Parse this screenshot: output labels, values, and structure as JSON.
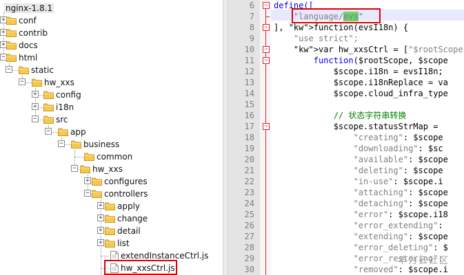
{
  "tree": {
    "root": "nginx-1.8.1",
    "items": [
      {
        "label": "conf"
      },
      {
        "label": "contrib"
      },
      {
        "label": "docs"
      },
      {
        "label": "html"
      },
      {
        "label": "static"
      },
      {
        "label": "hw_xxs"
      },
      {
        "label": "config"
      },
      {
        "label": "i18n"
      },
      {
        "label": "src"
      },
      {
        "label": "app"
      },
      {
        "label": "business"
      },
      {
        "label": "common"
      },
      {
        "label": "hw_xxs"
      },
      {
        "label": "configures"
      },
      {
        "label": "controllers"
      },
      {
        "label": "apply"
      },
      {
        "label": "change"
      },
      {
        "label": "detail"
      },
      {
        "label": "list"
      },
      {
        "label": "extendInstanceCtrl.js"
      },
      {
        "label": "hw_xxsCtrl.js"
      }
    ],
    "colors": {
      "folder": "#f4c94c",
      "highlight_box": "#e00000"
    }
  },
  "editor": {
    "lines": [
      {
        "n": "6",
        "t": "define(["
      },
      {
        "n": "7",
        "a": "\"language/",
        "h": "evs",
        "b": "\""
      },
      {
        "n": "8",
        "t": "], function(evsI18n) {"
      },
      {
        "n": "9",
        "t": "    \"use strict\";"
      },
      {
        "n": "10",
        "t": "    var hw_xxsCtrl = [\"$rootScope\""
      },
      {
        "n": "11",
        "t": "        function($rootScope, $scope"
      },
      {
        "n": "12",
        "t": "            $scope.i18n = evsI18n;"
      },
      {
        "n": "13",
        "t": "            $scope.i18nReplace = va"
      },
      {
        "n": "14",
        "t": "            $scope.cloud_infra_type"
      },
      {
        "n": "15",
        "t": ""
      },
      {
        "n": "16",
        "t": "            // 状态字符串转换"
      },
      {
        "n": "17",
        "t": "            $scope.statusStrMap = "
      },
      {
        "n": "18",
        "t": "                \"creating\": $scope"
      },
      {
        "n": "19",
        "t": "                \"downloading\": $sc"
      },
      {
        "n": "20",
        "t": "                \"available\": $scope"
      },
      {
        "n": "21",
        "t": "                \"deleting\": $scope"
      },
      {
        "n": "22",
        "t": "                \"in-use\": $scope.i"
      },
      {
        "n": "23",
        "t": "                \"attaching\": $scope"
      },
      {
        "n": "24",
        "t": "                \"detaching\": $scope"
      },
      {
        "n": "25",
        "t": "                \"error\": $scope.i18"
      },
      {
        "n": "26",
        "t": "                \"error_extending\":"
      },
      {
        "n": "27",
        "t": "                \"extending\": $scope"
      },
      {
        "n": "28",
        "t": "                \"error_deleting\": $"
      },
      {
        "n": "29",
        "t": "                \"error_restoring\":"
      },
      {
        "n": "30",
        "t": "                \"removed\": $scope.i"
      }
    ]
  },
  "watermark": "华为云社区"
}
